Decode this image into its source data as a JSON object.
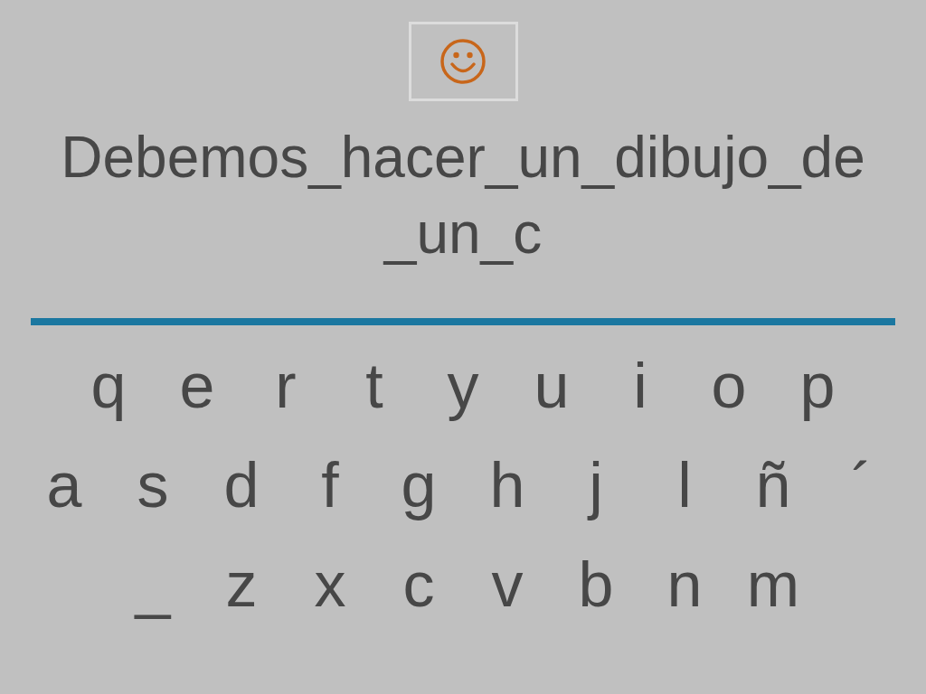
{
  "hint_button": {
    "kind": "smiley"
  },
  "prompt": {
    "lines": [
      "Debemos_hacer_un_dibujo_de",
      "_un_c"
    ]
  },
  "keyboard": {
    "rows": [
      [
        "q",
        "e",
        "r",
        "t",
        "y",
        "u",
        "i",
        "o",
        "p"
      ],
      [
        "a",
        "s",
        "d",
        "f",
        "g",
        "h",
        "j",
        "l",
        "ñ",
        "´"
      ],
      [
        "_",
        "z",
        "x",
        "c",
        "v",
        "b",
        "n",
        "m"
      ]
    ]
  }
}
